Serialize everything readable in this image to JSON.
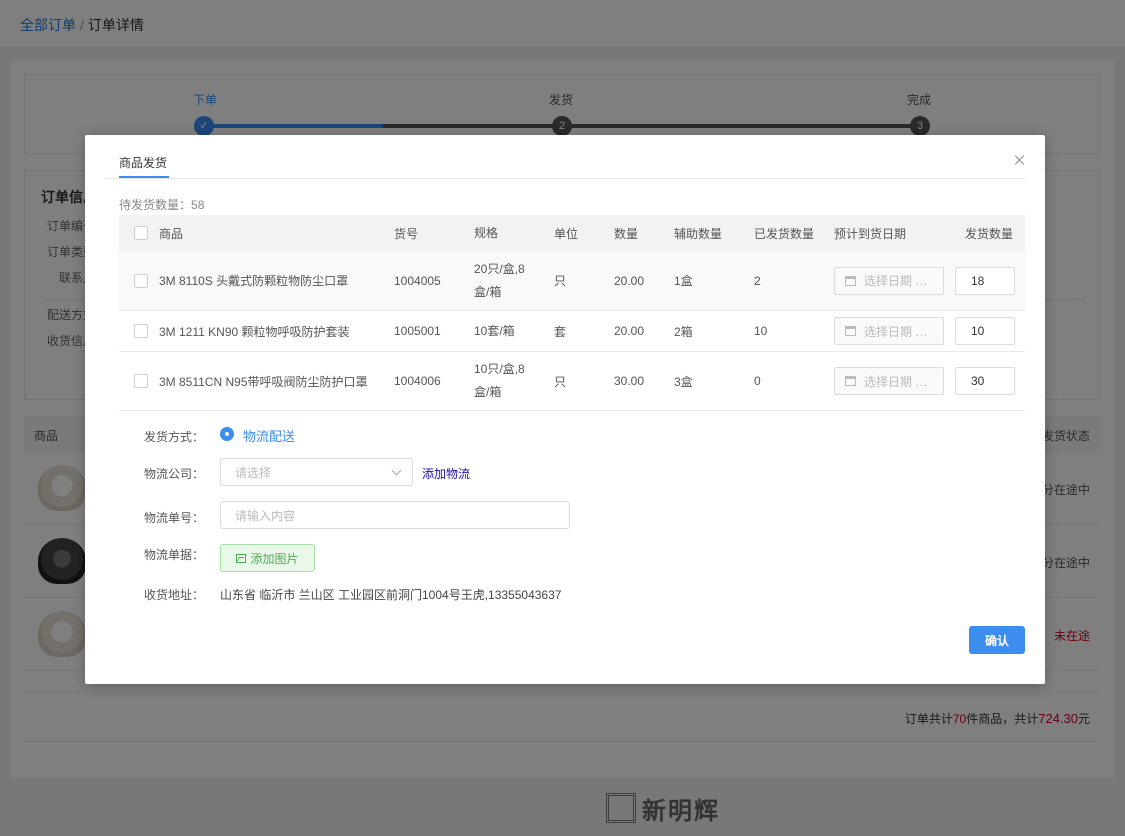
{
  "breadcrumb": {
    "root": "全部订单",
    "sep": "/",
    "current": "订单详情"
  },
  "steps": [
    {
      "label": "下单",
      "mark": "✓"
    },
    {
      "label": "发货",
      "mark": "2"
    },
    {
      "label": "完成",
      "mark": "3"
    }
  ],
  "order_info": {
    "title": "订单信息",
    "rows": [
      "订单编号",
      "订单类型",
      "联系人",
      "配送方式",
      "收货信息"
    ]
  },
  "goods_table": {
    "col_product": "商品",
    "col_status": "发货状态",
    "rows": [
      {
        "status": "部分在途中"
      },
      {
        "status": "部分在途中"
      },
      {
        "status": "未在途"
      }
    ]
  },
  "summary": {
    "prefix": "订单共计",
    "count": "70",
    "mid": "件商品，共计",
    "amount": "724.30",
    "suffix": "元"
  },
  "footer": {
    "logo_text": "新明辉"
  },
  "modal": {
    "tab": "商品发货",
    "pending_label": "待发货数量：",
    "pending_count": "58",
    "columns": {
      "product": "商品",
      "sku": "货号",
      "spec": "规格",
      "unit": "单位",
      "qty": "数量",
      "aux": "辅助数量",
      "shipped": "已发货数量",
      "eta": "预计到货日期",
      "send": "发货数量"
    },
    "date_placeholder": "选择日期 …",
    "items": [
      {
        "name": "3M 8110S 头戴式防颗粒物防尘口罩",
        "sku": "1004005",
        "spec": "20只/盒,8盒/箱",
        "unit": "只",
        "qty": "20.00",
        "aux": "1盒",
        "shipped": "2",
        "send": "18"
      },
      {
        "name": "3M 1211 KN90 颗粒物呼吸防护套装",
        "sku": "1005001",
        "spec": "10套/箱",
        "unit": "套",
        "qty": "20.00",
        "aux": "2箱",
        "shipped": "10",
        "send": "10"
      },
      {
        "name": "3M 8511CN N95带呼吸阀防尘防护口罩",
        "sku": "1004006",
        "spec": "10只/盒,8盒/箱",
        "unit": "只",
        "qty": "30.00",
        "aux": "3盒",
        "shipped": "0",
        "send": "30"
      }
    ],
    "form": {
      "method_label": "发货方式：",
      "method_value": "物流配送",
      "company_label": "物流公司：",
      "company_placeholder": "请选择",
      "add_logistics": "添加物流",
      "tracking_label": "物流单号：",
      "tracking_placeholder": "请输入内容",
      "receipt_label": "物流单据：",
      "add_image": "添加图片",
      "address_label": "收货地址：",
      "address": "山东省 临沂市 兰山区 工业园区前洞门1004号王虎,13355043637"
    },
    "confirm": "确认"
  }
}
